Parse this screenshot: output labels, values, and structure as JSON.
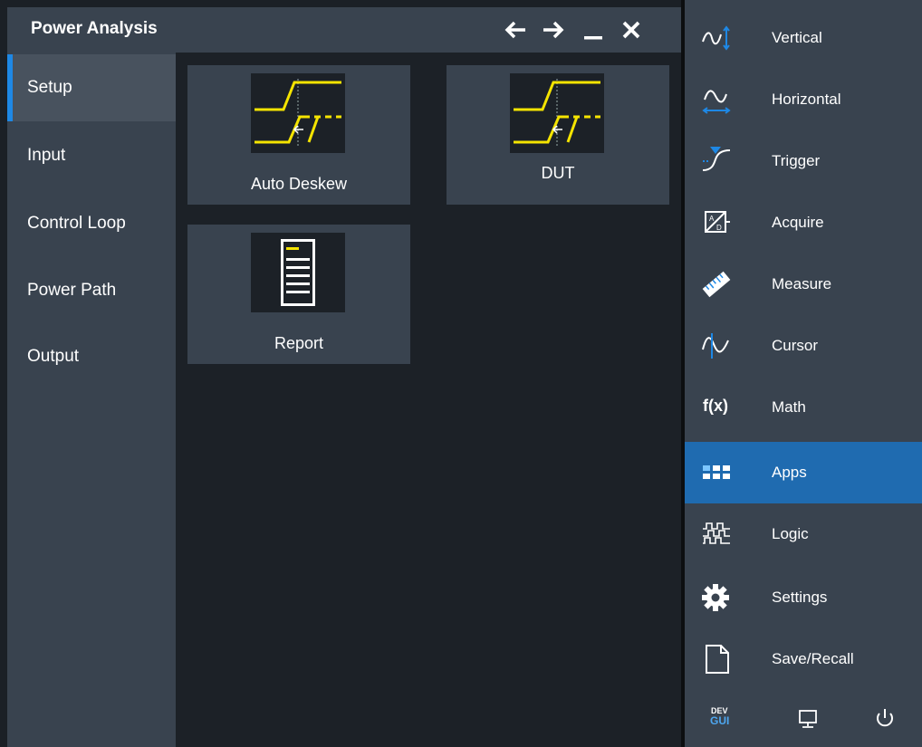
{
  "dialog": {
    "title": "Power Analysis",
    "controls": [
      "back-arrow-icon",
      "forward-arrow-icon",
      "minimize-icon",
      "close-icon"
    ]
  },
  "nav": {
    "items": [
      {
        "label": "Setup",
        "active": true
      },
      {
        "label": "Input",
        "active": false
      },
      {
        "label": "Control Loop",
        "active": false
      },
      {
        "label": "Power Path",
        "active": false
      },
      {
        "label": "Output",
        "active": false
      }
    ]
  },
  "tiles": [
    {
      "label": "Auto Deskew",
      "icon": "deskew-waveform-icon"
    },
    {
      "label": "DUT",
      "icon": "deskew-waveform-icon"
    },
    {
      "label": "Report",
      "icon": "report-document-icon"
    }
  ],
  "menu": {
    "items": [
      {
        "label": "Vertical",
        "icon": "vertical-icon",
        "active": false
      },
      {
        "label": "Horizontal",
        "icon": "horizontal-icon",
        "active": false
      },
      {
        "label": "Trigger",
        "icon": "trigger-icon",
        "active": false
      },
      {
        "label": "Acquire",
        "icon": "acquire-icon",
        "active": false
      },
      {
        "label": "Measure",
        "icon": "ruler-icon",
        "active": false
      },
      {
        "label": "Cursor",
        "icon": "cursor-icon",
        "active": false
      },
      {
        "label": "Math",
        "icon": "fx-icon",
        "active": false
      },
      {
        "label": "Apps",
        "icon": "apps-grid-icon",
        "active": true
      },
      {
        "label": "Logic",
        "icon": "logic-icon",
        "active": false
      },
      {
        "label": "Settings",
        "icon": "gear-icon",
        "active": false
      },
      {
        "label": "Save/Recall",
        "icon": "document-icon",
        "active": false
      }
    ],
    "math_icon_text": "f(x)",
    "bottom": {
      "dev_top": "DEV",
      "dev_bottom": "GUI",
      "icons": [
        "dev-gui-icon",
        "monitor-icon",
        "power-icon"
      ]
    }
  },
  "colors": {
    "accent": "#1e88e5",
    "active_menu": "#1f6bb0",
    "waveform_yellow": "#f5e400",
    "panel": "#39434f",
    "background": "#1c2127"
  }
}
